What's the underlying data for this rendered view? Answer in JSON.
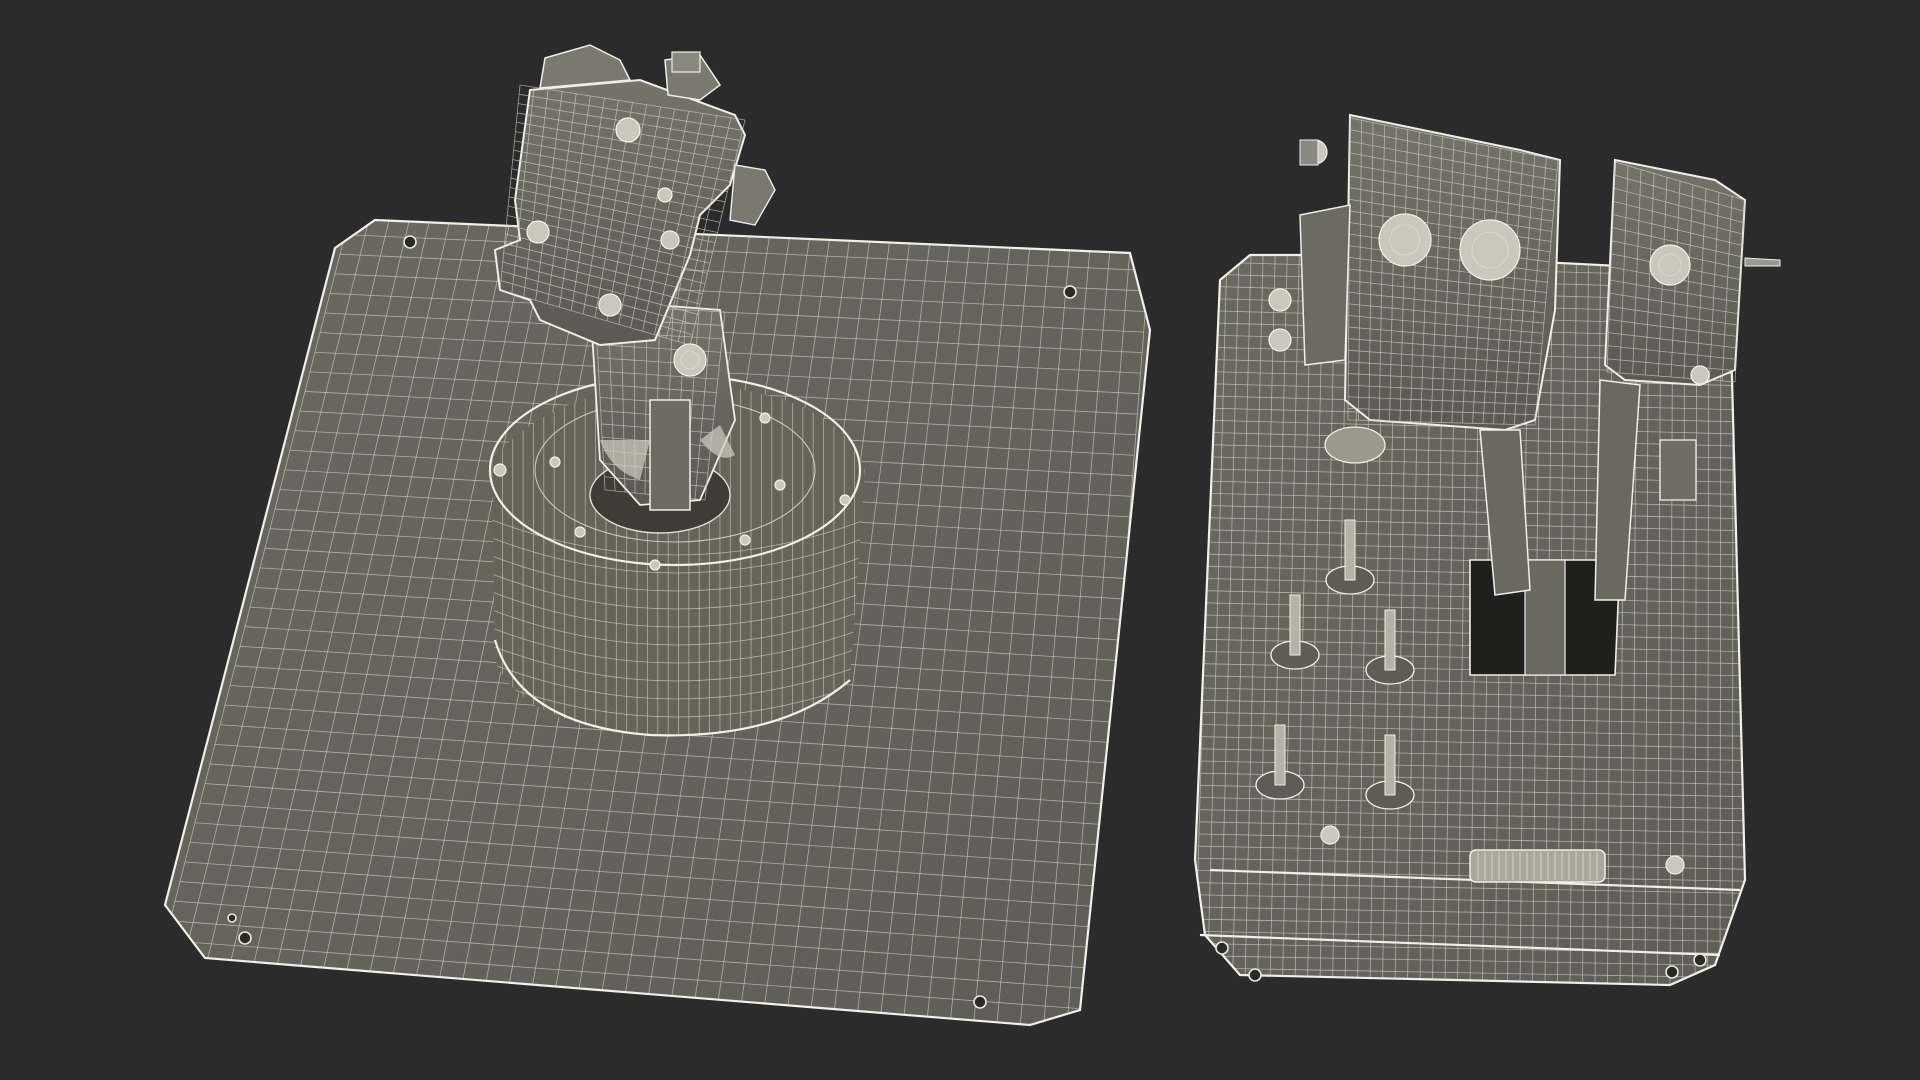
{
  "scene": {
    "background_color": "#2b2b2b",
    "wire_color": "#d8d8cc",
    "surface_color": "#6e6d64",
    "objects": [
      {
        "name": "joystick-model",
        "description_icon": "joystick-icon"
      },
      {
        "name": "throttle-model",
        "description_icon": "throttle-icon"
      }
    ]
  }
}
